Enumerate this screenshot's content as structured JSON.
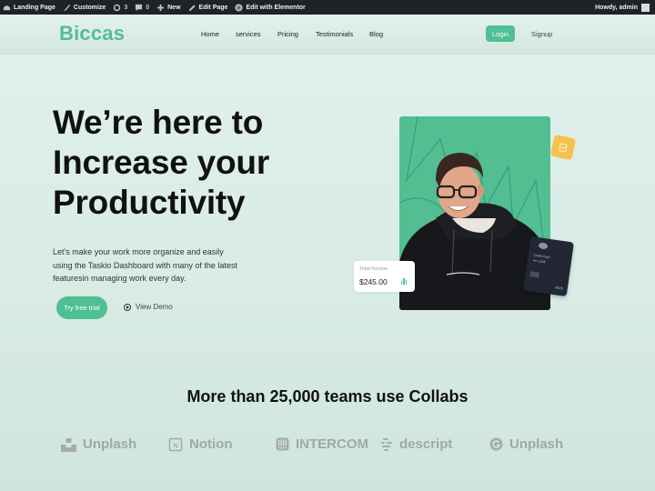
{
  "admin_bar": {
    "items": [
      {
        "icon": "dashboard-icon",
        "label": "Landing Page"
      },
      {
        "icon": "customize-icon",
        "label": "Customize"
      },
      {
        "icon": "updates-icon",
        "label": "3"
      },
      {
        "icon": "comments-icon",
        "label": "0"
      },
      {
        "icon": "plus-icon",
        "label": "New"
      },
      {
        "icon": "edit-icon",
        "label": "Edit Page"
      },
      {
        "icon": "elementor-icon",
        "label": "Edit with Elementor"
      }
    ],
    "greeting": "Howdy, admin"
  },
  "header": {
    "logo": "Biccas",
    "nav": [
      "Home",
      "services",
      "Pricing",
      "Testimonials",
      "Blog"
    ],
    "login_label": "Login",
    "signup_label": "Signup"
  },
  "hero": {
    "title_lines": [
      "We’re here to",
      "Increase your",
      "Productivity"
    ],
    "description_lines": [
      "Let's make your work more organize and easily",
      "using the Taskio Dashboard with many of the latest",
      "featuresin managing work every day."
    ],
    "primary_cta": "Try free trial",
    "secondary_cta": "View Demo",
    "income_card": {
      "label": "Total Income",
      "value": "$245.00"
    },
    "credit_card": {
      "name": "Credit Card",
      "number": "•••• 1234",
      "expiry": "09/25"
    }
  },
  "social_proof": {
    "title": "More than 25,000 teams use Collabs",
    "brands": [
      {
        "icon": "unsplash-icon",
        "name": "Unplash"
      },
      {
        "icon": "notion-icon",
        "name": "Notion"
      },
      {
        "icon": "intercom-icon",
        "name": "INTERCOM"
      },
      {
        "icon": "descript-icon",
        "name": "descript"
      },
      {
        "icon": "grammarly-icon",
        "name": "Unplash"
      }
    ]
  },
  "colors": {
    "brand_green": "#4fbf94",
    "admin_bar": "#1d2327",
    "accent_yellow": "#f6c24f",
    "card_dark": "#232733"
  }
}
